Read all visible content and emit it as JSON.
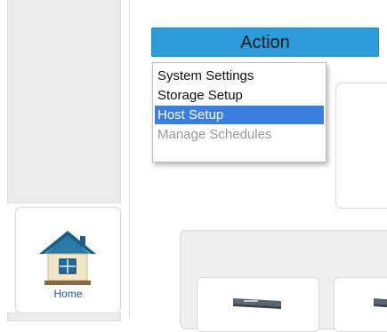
{
  "action_menu": {
    "button_label": "Action",
    "items": [
      {
        "label": "System Settings",
        "state": "normal"
      },
      {
        "label": "Storage Setup",
        "state": "normal"
      },
      {
        "label": "Host Setup",
        "state": "selected"
      },
      {
        "label": "Manage Schedules",
        "state": "disabled"
      }
    ]
  },
  "home_tile": {
    "label": "Home",
    "icon": "house-icon"
  },
  "colors": {
    "action_button": "#2d9bd9",
    "selected_item": "#3a7fe0",
    "disabled_text": "#9a9a9a",
    "home_label": "#1f5a9c"
  }
}
